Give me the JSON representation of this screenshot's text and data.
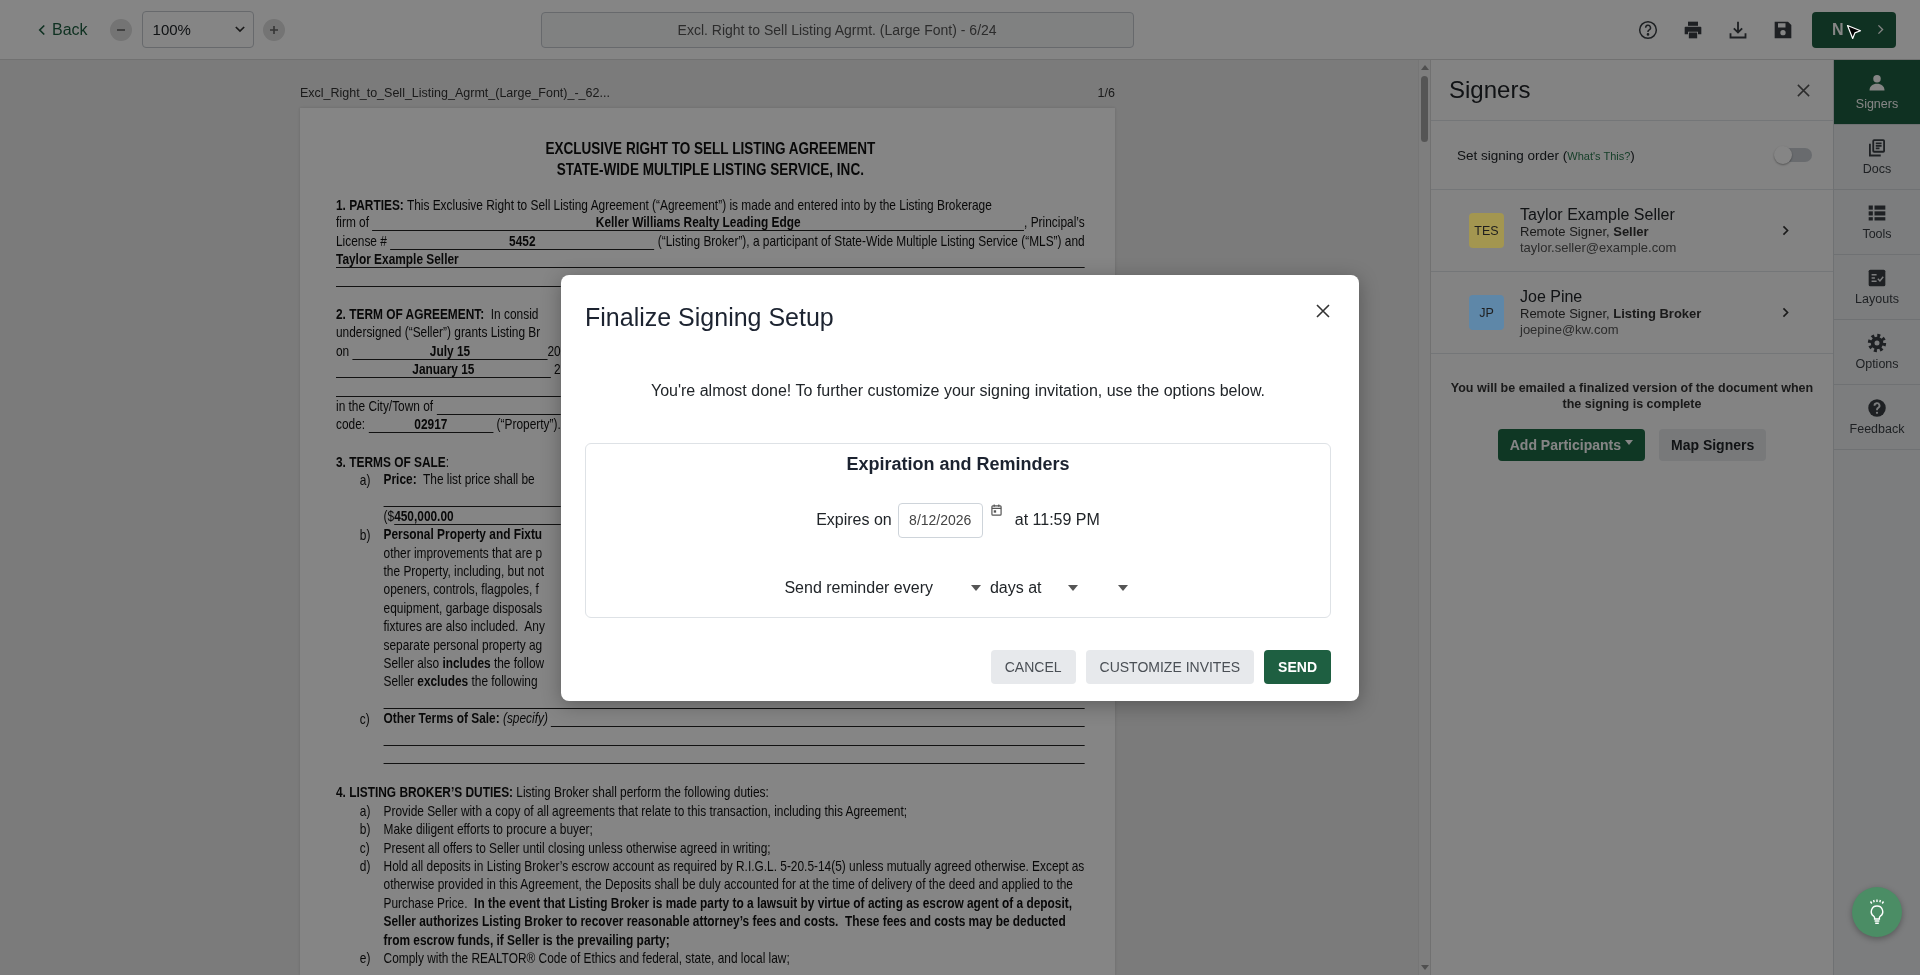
{
  "toolbar": {
    "back": "Back",
    "zoom": "100%",
    "document_title": "Excl. Right to Sell Listing Agrmt. (Large Font) - 6/24",
    "next": "N"
  },
  "document": {
    "file_name": "Excl_Right_to_Sell_Listing_Agrmt_(Large_Font)_-_62...",
    "page": "1/6",
    "title": [
      "EXCLUSIVE RIGHT TO SELL LISTING AGREEMENT",
      "STATE-WIDE MULTIPLE LISTING SERVICE, INC."
    ],
    "sections": [
      {
        "lines": [
          {
            "parts": [
              {
                "kind": "text",
                "text": "**1. PARTIES:** This Exclusive Right to Sell Listing Agreement (“Agreement”) is made and entered into by the Listing Brokerage"
              }
            ]
          },
          {
            "parts": [
              {
                "kind": "text",
                "text": "firm of "
              },
              {
                "kind": "field",
                "text": "Keller Williams Realty Leading Edge"
              },
              {
                "kind": "text",
                "text": ", Principal’s"
              }
            ]
          },
          {
            "parts": [
              {
                "kind": "text",
                "text": "License # "
              },
              {
                "kind": "field",
                "text": "5452"
              },
              {
                "kind": "text",
                "text": " (“Listing Broker”), a participant of State-Wide Multiple Listing Service (“MLS”) and"
              }
            ]
          },
          {
            "parts": [
              {
                "kind": "field",
                "text": "Taylor Example Seller"
              }
            ]
          },
          {
            "covered": true,
            "parts": [
              {
                "kind": "field"
              }
            ]
          }
        ]
      },
      {
        "lines": [
          {
            "covered": true,
            "parts": [
              {
                "kind": "text",
                "text": "**2. TERM OF AGREEMENT:**  In consid"
              }
            ]
          },
          {
            "covered": true,
            "parts": [
              {
                "kind": "text",
                "text": "undersigned (“Seller”) grants Listing Br"
              }
            ]
          },
          {
            "covered": true,
            "parts": [
              {
                "kind": "text",
                "text": "on "
              },
              {
                "kind": "field",
                "text": "July 15"
              },
              {
                "kind": "text",
                "text": "20"
              }
            ]
          },
          {
            "covered": true,
            "parts": [
              {
                "kind": "field",
                "text": "January 15"
              },
              {
                "kind": "text",
                "text": " 2"
              }
            ]
          },
          {
            "covered": true,
            "parts": [
              {
                "kind": "field"
              }
            ]
          },
          {
            "covered": true,
            "parts": [
              {
                "kind": "text",
                "text": "in the City/Town of "
              },
              {
                "kind": "field"
              }
            ]
          },
          {
            "covered": true,
            "parts": [
              {
                "kind": "text",
                "text": "code: "
              },
              {
                "kind": "field",
                "text": "02917"
              },
              {
                "kind": "text",
                "text": " (“Property”)."
              }
            ]
          }
        ]
      },
      {
        "lines": [
          {
            "parts": [
              {
                "kind": "text",
                "text": "**3. TERMS OF SALE**:"
              }
            ]
          }
        ],
        "items": [
          {
            "marker": "a)",
            "lines": [
              {
                "covered": true,
                "parts": [
                  {
                    "kind": "text",
                    "text": "**Price:**  The list price shall be"
                  }
                ]
              },
              {
                "covered": true,
                "parts": [
                  {
                    "kind": "field"
                  }
                ]
              },
              {
                "covered": true,
                "parts": [
                  {
                    "kind": "text",
                    "text": "($"
                  },
                  {
                    "kind": "field",
                    "text": "450,000.00"
                  }
                ]
              }
            ]
          },
          {
            "marker": "b)",
            "lines": [
              {
                "covered": true,
                "parts": [
                  {
                    "kind": "text",
                    "text": "**Personal Property and Fixtu**"
                  }
                ]
              },
              {
                "covered": true,
                "parts": [
                  {
                    "kind": "text",
                    "text": "other improvements that are p"
                  }
                ]
              },
              {
                "covered": true,
                "parts": [
                  {
                    "kind": "text",
                    "text": "the Property, including, but not"
                  }
                ]
              },
              {
                "covered": true,
                "parts": [
                  {
                    "kind": "text",
                    "text": "openers, controls, flagpoles, f"
                  }
                ]
              },
              {
                "covered": true,
                "parts": [
                  {
                    "kind": "text",
                    "text": "equipment, garbage disposals"
                  }
                ]
              },
              {
                "covered": true,
                "parts": [
                  {
                    "kind": "text",
                    "text": "fixtures are also included.  Any"
                  }
                ]
              },
              {
                "covered": true,
                "parts": [
                  {
                    "kind": "text",
                    "text": "separate personal property ag"
                  }
                ]
              },
              {
                "covered": true,
                "parts": [
                  {
                    "kind": "text",
                    "text": "Seller also **includes** the follow"
                  }
                ]
              },
              {
                "covered": true,
                "parts": [
                  {
                    "kind": "text",
                    "text": "Seller **excludes** the following"
                  }
                ]
              },
              {
                "parts": [
                  {
                    "kind": "field"
                  }
                ]
              }
            ]
          },
          {
            "marker": "c)",
            "lines": [
              {
                "parts": [
                  {
                    "kind": "text",
                    "text": "**Other Terms of Sale:** *(specify)* "
                  },
                  {
                    "kind": "field"
                  }
                ]
              },
              {
                "parts": [
                  {
                    "kind": "field"
                  }
                ]
              },
              {
                "parts": [
                  {
                    "kind": "field"
                  }
                ]
              }
            ]
          }
        ]
      },
      {
        "lines": [
          {
            "parts": [
              {
                "kind": "text",
                "text": "**4. LISTING BROKER’S DUTIES:** Listing Broker shall perform the following duties:"
              }
            ]
          }
        ],
        "items": [
          {
            "marker": "a)",
            "lines": [
              {
                "parts": [
                  {
                    "kind": "text",
                    "text": "Provide Seller with a copy of all agreements that relate to this transaction, including this Agreement;"
                  }
                ]
              }
            ]
          },
          {
            "marker": "b)",
            "lines": [
              {
                "parts": [
                  {
                    "kind": "text",
                    "text": "Make diligent efforts to procure a buyer;"
                  }
                ]
              }
            ]
          },
          {
            "marker": "c)",
            "lines": [
              {
                "parts": [
                  {
                    "kind": "text",
                    "text": "Present all offers to Seller until closing unless otherwise agreed in writing;"
                  }
                ]
              }
            ]
          },
          {
            "marker": "d)",
            "lines": [
              {
                "parts": [
                  {
                    "kind": "text",
                    "text": "Hold all deposits in Listing Broker’s escrow account as required by R.I.G.L. 5-20.5-14(5) unless mutually agreed otherwise. Except as otherwise provided in this Agreement, the Deposits shall be duly accounted for at the time of delivery of the deed and applied to the Purchase Price.  **In the event that Listing Broker is made party to a lawsuit by virtue of acting as escrow agent of a deposit, Seller authorizes Listing Broker to recover reasonable attorney’s fees and costs.  These fees and costs may be deducted from escrow funds, if Seller is the prevailing party;**"
                  }
                ]
              }
            ]
          },
          {
            "marker": "e)",
            "lines": [
              {
                "parts": [
                  {
                    "kind": "text",
                    "text": "Comply with the REALTOR® Code of Ethics and federal, state, and local law;"
                  }
                ]
              }
            ]
          }
        ]
      }
    ]
  },
  "signers_panel": {
    "title": "Signers",
    "signing_order": {
      "label": "Set signing order (",
      "link": "What's This?",
      "label_end": ")",
      "on": false
    },
    "signers": [
      {
        "initials": "TES",
        "color": "#a39650",
        "name": "Taylor Example Seller",
        "role": "Remote Signer, **Seller**",
        "email": "taylor.seller@example.com"
      },
      {
        "initials": "JP",
        "color": "#5e87a8",
        "name": "Joe Pine",
        "role": "Remote Signer, **Listing Broker**",
        "email": "joepine@kw.com"
      }
    ],
    "note": "You will be emailed a finalized version of the document when the signing is complete",
    "buttons": [
      "Add Participants",
      "Map Signers"
    ]
  },
  "rail": [
    {
      "label": "Signers",
      "selected": true
    },
    {
      "label": "Docs",
      "selected": false
    },
    {
      "label": "Tools",
      "selected": false
    },
    {
      "label": "Layouts",
      "selected": false
    },
    {
      "label": "Options",
      "selected": false
    },
    {
      "label": "Feedback",
      "selected": false
    }
  ],
  "modal": {
    "title": "Finalize Signing Setup",
    "message": "You're almost done! To further customize your signing invitation, use the options below.",
    "section": {
      "title": "Expiration and Reminders",
      "expires_label": "Expires on",
      "expires_date": "8/12/2026",
      "expires_time": "at 11:59 PM",
      "reminder_label": "Send reminder every",
      "reminder_unit": "days at"
    },
    "buttons": [
      {
        "label": "CANCEL",
        "kind": "secondary"
      },
      {
        "label": "CUSTOMIZE INVITES",
        "kind": "secondary"
      },
      {
        "label": "SEND",
        "kind": "primary"
      }
    ]
  }
}
